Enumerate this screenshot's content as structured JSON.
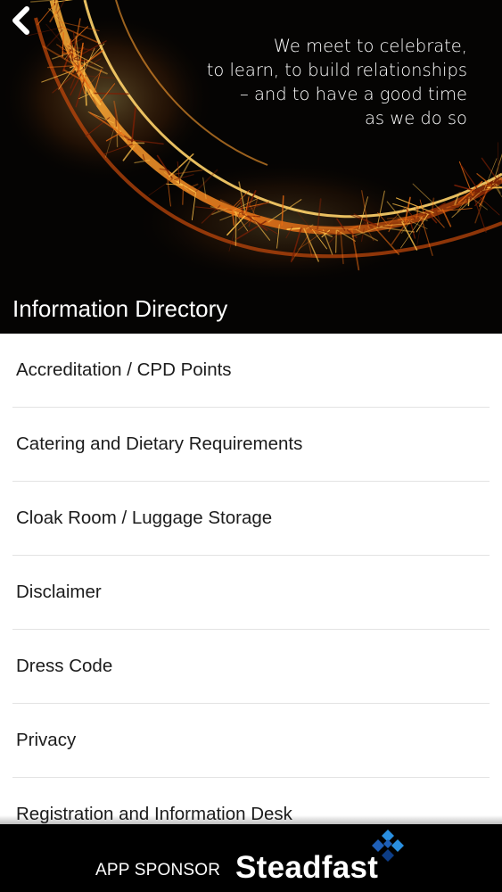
{
  "header": {
    "back_icon": "chevron-left-icon",
    "tagline": [
      "We meet to celebrate,",
      "to learn, to build relationships",
      "– and to have a good time",
      "as we do so"
    ],
    "title": "Information Directory"
  },
  "directory": {
    "items": [
      {
        "label": "Accreditation / CPD Points"
      },
      {
        "label": "Catering and Dietary Requirements"
      },
      {
        "label": "Cloak Room / Luggage Storage"
      },
      {
        "label": "Disclaimer"
      },
      {
        "label": "Dress Code"
      },
      {
        "label": "Privacy"
      },
      {
        "label": "Registration and Information Desk"
      }
    ]
  },
  "footer": {
    "sponsor_label": "APP SPONSOR",
    "sponsor_name": "Steadfast",
    "logo_icon": "diamond-cluster-logo",
    "logo_colors": [
      "#1e5fb8",
      "#2a8fe0",
      "#0d3d86"
    ]
  },
  "colors": {
    "hero_background": "#050403",
    "spark_bright": "#ffc24a",
    "spark_mid": "#e86a12",
    "spark_dark": "#7a1f05",
    "footer_background": "#000000",
    "text_dark": "#1c1c1c",
    "divider": "#e3e3e3"
  }
}
